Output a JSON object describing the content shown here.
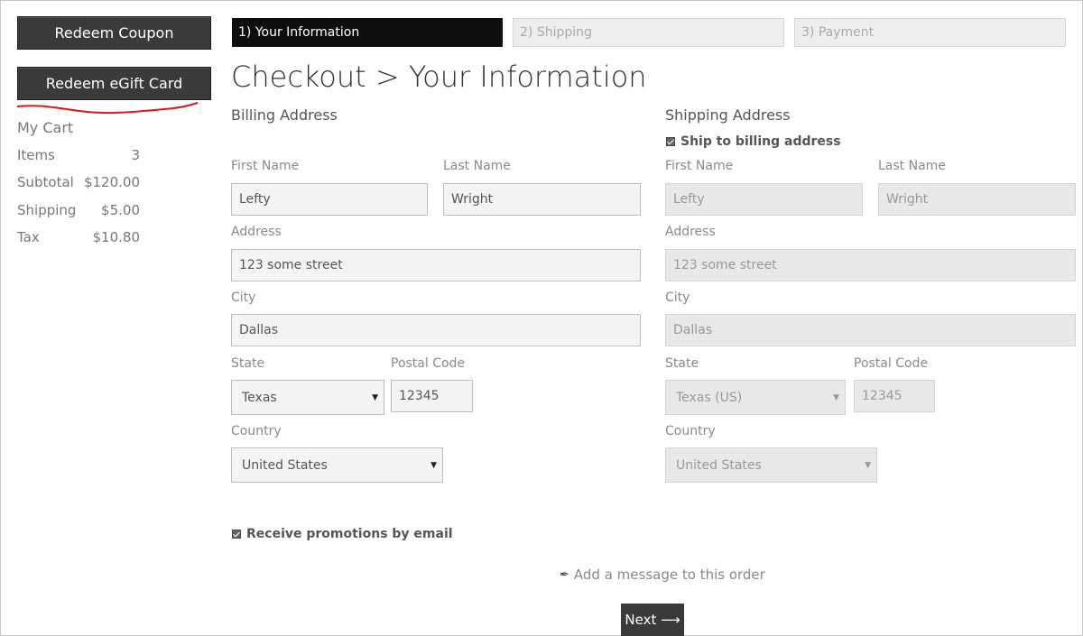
{
  "sidebar": {
    "redeem_coupon": "Redeem Coupon",
    "redeem_egift": "Redeem eGift Card",
    "cart_title": "My Cart",
    "summary": [
      {
        "label": "Items",
        "value": "3"
      },
      {
        "label": "Subtotal",
        "value": "$120.00"
      },
      {
        "label": "Shipping",
        "value": "$5.00"
      },
      {
        "label": "Tax",
        "value": "$10.80"
      }
    ]
  },
  "steps": [
    "1) Your Information",
    "2) Shipping",
    "3) Payment"
  ],
  "page_title": "Checkout > Your Information",
  "billing": {
    "heading": "Billing Address",
    "first_name_label": "First Name",
    "first_name": "Lefty",
    "last_name_label": "Last Name",
    "last_name": "Wright",
    "address_label": "Address",
    "address": "123 some street",
    "city_label": "City",
    "city": "Dallas",
    "state_label": "State",
    "state": "Texas",
    "postal_label": "Postal Code",
    "postal": "12345",
    "country_label": "Country",
    "country": "United States"
  },
  "shipping": {
    "heading": "Shipping Address",
    "same_as_billing": "Ship to billing address",
    "first_name_label": "First Name",
    "first_name": "Lefty",
    "last_name_label": "Last Name",
    "last_name": "Wright",
    "address_label": "Address",
    "address": "123 some street",
    "city_label": "City",
    "city": "Dallas",
    "state_label": "State",
    "state": "Texas (US)",
    "postal_label": "Postal Code",
    "postal": "12345",
    "country_label": "Country",
    "country": "United States"
  },
  "promotions": "Receive promotions by email",
  "add_message": "Add a message to this order",
  "next_label": "Next ⟶",
  "icons": {
    "select_caret": "▼",
    "feather": "✒"
  },
  "colors": {
    "dark_button": "#3a3a3a",
    "active_step": "#0e0e0e",
    "annotation": "#d81818"
  }
}
